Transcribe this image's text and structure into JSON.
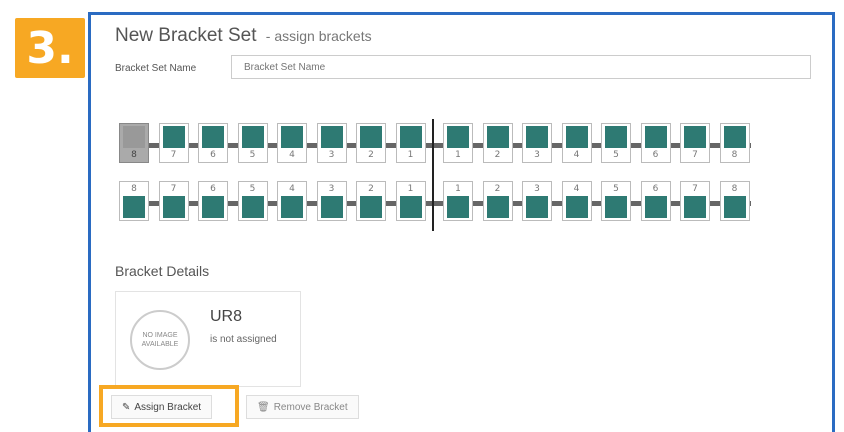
{
  "step": {
    "label": "3."
  },
  "header": {
    "title": "New Bracket Set",
    "subtitle": "- assign brackets"
  },
  "form": {
    "name_label": "Bracket Set Name",
    "name_placeholder": "Bracket Set Name"
  },
  "upper_arch": {
    "teeth": [
      "8",
      "7",
      "6",
      "5",
      "4",
      "3",
      "2",
      "1",
      "1",
      "2",
      "3",
      "4",
      "5",
      "6",
      "7",
      "8"
    ],
    "selected_index": 0
  },
  "lower_arch": {
    "teeth": [
      "8",
      "7",
      "6",
      "5",
      "4",
      "3",
      "2",
      "1",
      "1",
      "2",
      "3",
      "4",
      "5",
      "6",
      "7",
      "8"
    ]
  },
  "details": {
    "heading": "Bracket Details",
    "no_image_line1": "NO IMAGE",
    "no_image_line2": "AVAILABLE",
    "code": "UR8",
    "status": "is not assigned"
  },
  "actions": {
    "assign_label": "Assign Bracket",
    "remove_label": "Remove Bracket"
  },
  "colors": {
    "accent": "#f7a823",
    "panel_border": "#2a6bc2",
    "tooth": "#2e7a73"
  }
}
